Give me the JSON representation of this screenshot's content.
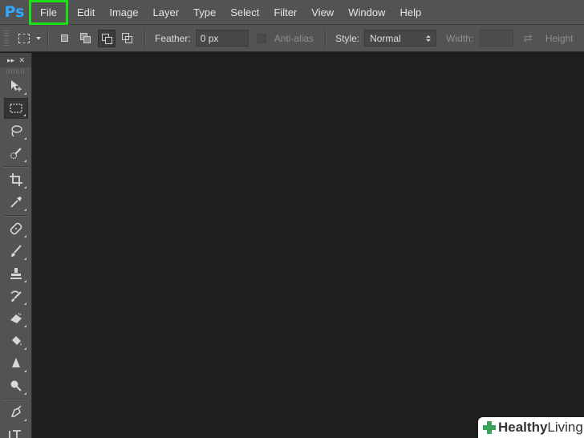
{
  "app": {
    "logo": "Ps"
  },
  "menu": {
    "items": [
      "File",
      "Edit",
      "Image",
      "Layer",
      "Type",
      "Select",
      "Filter",
      "View",
      "Window",
      "Help"
    ],
    "highlight_color": "#19e019"
  },
  "options": {
    "feather_label": "Feather:",
    "feather_value": "0 px",
    "antialias_label": "Anti-alias",
    "style_label": "Style:",
    "style_value": "Normal",
    "width_label": "Width:",
    "height_label": "Height"
  },
  "toolbar": {
    "tools": [
      "move-tool-icon",
      "rectangular-marquee-icon",
      "lasso-icon",
      "quick-selection-icon",
      "crop-icon",
      "eyedropper-icon",
      "healing-brush-icon",
      "brush-icon",
      "clone-stamp-icon",
      "history-brush-icon",
      "eraser-icon",
      "paint-bucket-icon",
      "blur-icon",
      "dodge-icon",
      "pen-icon",
      "type-icon"
    ]
  },
  "watermark": {
    "bold": "Healthy",
    "normal": " Living",
    "accent": "#3aa35e"
  },
  "colors": {
    "chrome": "#535353",
    "canvas": "#1e1e1e",
    "logo": "#31a8ff"
  }
}
